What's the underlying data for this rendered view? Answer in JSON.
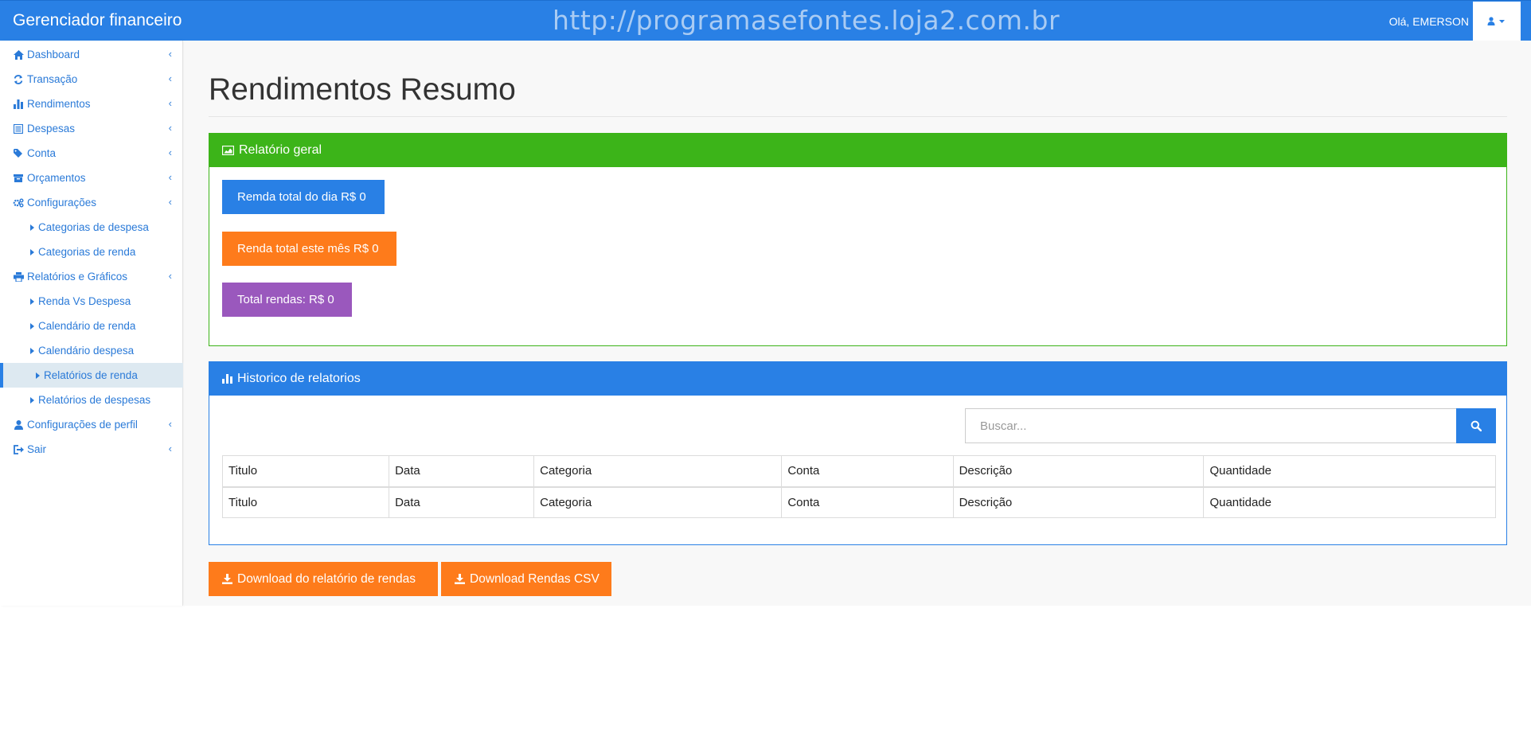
{
  "navbar": {
    "brand": "Gerenciador financeiro",
    "watermark": "http://programasefontes.loja2.com.br",
    "greeting": "Olá, EMERSON"
  },
  "sidebar": {
    "items": [
      {
        "label": "Dashboard",
        "icon": "home-icon",
        "level": "top",
        "chevron": true
      },
      {
        "label": "Transação",
        "icon": "refresh-icon",
        "level": "top",
        "chevron": true
      },
      {
        "label": "Rendimentos",
        "icon": "bar-chart-icon",
        "level": "top",
        "chevron": true
      },
      {
        "label": "Despesas",
        "icon": "list-icon",
        "level": "top",
        "chevron": true
      },
      {
        "label": "Conta",
        "icon": "tags-icon",
        "level": "top",
        "chevron": true
      },
      {
        "label": "Orçamentos",
        "icon": "archive-icon",
        "level": "top",
        "chevron": true
      },
      {
        "label": "Configurações",
        "icon": "cogs-icon",
        "level": "top",
        "chevron": true
      },
      {
        "label": "Categorias de despesa",
        "level": "sub"
      },
      {
        "label": "Categorias de renda",
        "level": "sub"
      },
      {
        "label": "Relatórios e Gráficos",
        "icon": "print-icon",
        "level": "top",
        "chevron": true
      },
      {
        "label": "Renda Vs Despesa",
        "level": "sub"
      },
      {
        "label": "Calendário de renda",
        "level": "sub"
      },
      {
        "label": "Calendário despesa",
        "level": "sub"
      },
      {
        "label": "Relatórios de renda",
        "level": "sub",
        "active": true
      },
      {
        "label": "Relatórios de despesas",
        "level": "sub"
      },
      {
        "label": "Configurações de perfil",
        "icon": "user-icon",
        "level": "top",
        "chevron": true
      },
      {
        "label": "Sair",
        "icon": "sign-out-icon",
        "level": "top",
        "chevron": true
      }
    ]
  },
  "main": {
    "title": "Rendimentos Resumo",
    "summary_panel": {
      "title": "Relatório geral",
      "day_total": "Remda total do dia R$ 0",
      "month_total": "Renda total este mês R$ 0",
      "grand_total": "Total rendas: R$ 0"
    },
    "history_panel": {
      "title": "Historico de relatorios",
      "search_placeholder": "Buscar...",
      "columns": [
        "Titulo",
        "Data",
        "Categoria",
        "Conta",
        "Descrição",
        "Quantidade"
      ],
      "rows": [
        [
          "Titulo",
          "Data",
          "Categoria",
          "Conta",
          "Descrição",
          "Quantidade"
        ]
      ]
    },
    "download_pdf": "Download do relatório de rendas",
    "download_csv": "Download Rendas CSV"
  },
  "colors": {
    "primary": "#2980e5",
    "success": "#3cb419",
    "warning": "#fe7b1b",
    "purple": "#9a58bd"
  }
}
